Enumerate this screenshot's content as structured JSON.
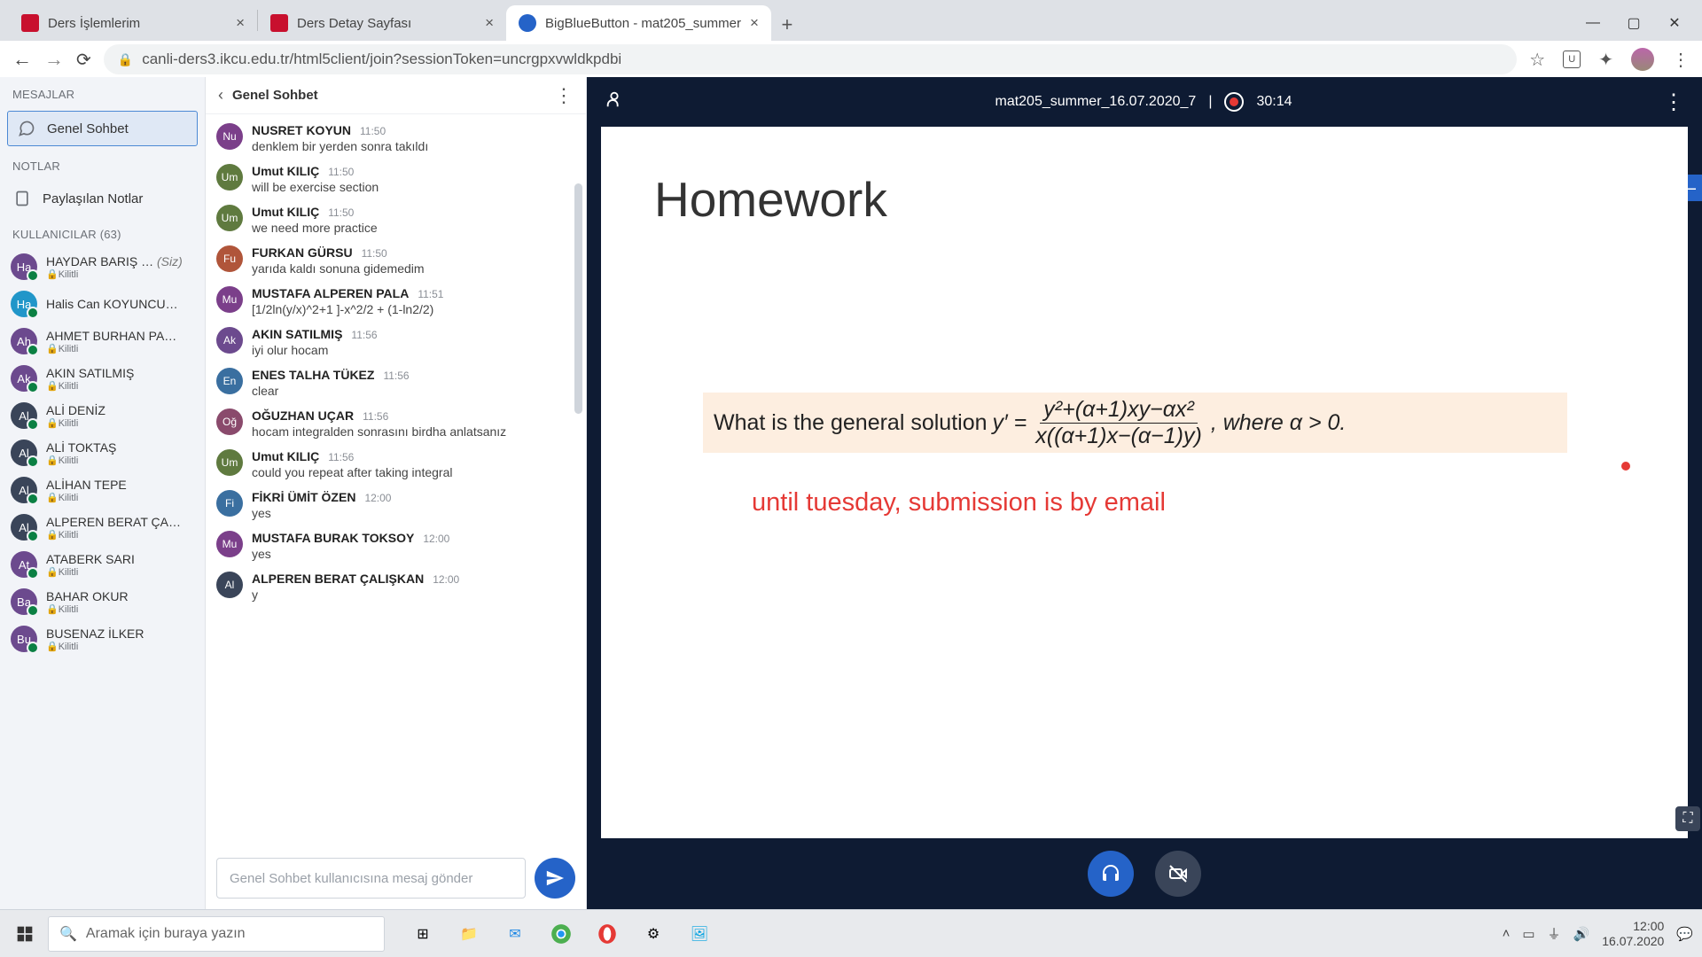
{
  "browser": {
    "tabs": [
      {
        "title": "Ders İşlemlerim",
        "favicon_color": "#c8102e"
      },
      {
        "title": "Ders Detay Sayfası",
        "favicon_color": "#c8102e"
      },
      {
        "title": "BigBlueButton - mat205_summer",
        "favicon_color": "#2563c8",
        "active": true
      }
    ],
    "url": "canli-ders3.ikcu.edu.tr/html5client/join?sessionToken=uncrgpxvwldkpdbi"
  },
  "sidebar": {
    "messages_header": "MESAJLAR",
    "public_chat": "Genel Sohbet",
    "notes_header": "NOTLAR",
    "shared_notes": "Paylaşılan Notlar",
    "users_header": "KULLANICILAR (63)",
    "users": [
      {
        "initials": "Ha",
        "name": "HAYDAR BARIŞ …",
        "suffix": "(Siz)",
        "sub": "Kilitli",
        "color": "#6c4a8e"
      },
      {
        "initials": "Ha",
        "name": "Halis Can KOYUNCU…",
        "sub": "",
        "color": "#2196c9",
        "presenter": true
      },
      {
        "initials": "Ah",
        "name": "AHMET BURHAN PA…",
        "sub": "Kilitli",
        "color": "#6c4a8e"
      },
      {
        "initials": "Ak",
        "name": "AKIN SATILMIŞ",
        "sub": "Kilitli",
        "color": "#6c4a8e"
      },
      {
        "initials": "Al",
        "name": "ALİ DENİZ",
        "sub": "Kilitli",
        "color": "#3a4559"
      },
      {
        "initials": "Al",
        "name": "ALİ TOKTAŞ",
        "sub": "Kilitli",
        "color": "#3a4559"
      },
      {
        "initials": "Al",
        "name": "ALİHAN TEPE",
        "sub": "Kilitli",
        "color": "#3a4559"
      },
      {
        "initials": "Al",
        "name": "ALPEREN BERAT ÇA…",
        "sub": "Kilitli",
        "color": "#3a4559"
      },
      {
        "initials": "At",
        "name": "ATABERK SARI",
        "sub": "Kilitli",
        "color": "#6c4a8e"
      },
      {
        "initials": "Ba",
        "name": "BAHAR OKUR",
        "sub": "Kilitli",
        "color": "#6c4a8e"
      },
      {
        "initials": "Bu",
        "name": "BUSENAZ İLKER",
        "sub": "Kilitli",
        "color": "#6c4a8e"
      }
    ]
  },
  "chat": {
    "title": "Genel Sohbet",
    "placeholder": "Genel Sohbet kullanıcısına mesaj gönder",
    "messages": [
      {
        "initials": "Nu",
        "color": "#7b3f8a",
        "name": "NUSRET KOYUN",
        "time": "11:50",
        "text": "denklem bir yerden sonra takıldı"
      },
      {
        "initials": "Um",
        "color": "#5f7a3f",
        "name": "Umut KILIÇ",
        "time": "11:50",
        "text": "will be exercise section"
      },
      {
        "initials": "Um",
        "color": "#5f7a3f",
        "name": "Umut KILIÇ",
        "time": "11:50",
        "text": "we need more practice"
      },
      {
        "initials": "Fu",
        "color": "#b0553a",
        "name": "FURKAN GÜRSU",
        "time": "11:50",
        "text": "yarıda kaldı sonuna gidemedim"
      },
      {
        "initials": "Mu",
        "color": "#7b3f8a",
        "name": "MUSTAFA ALPEREN PALA",
        "time": "11:51",
        "text": "[1/2ln(y/x)^2+1 ]-x^2/2 + (1-ln2/2)"
      },
      {
        "initials": "Ak",
        "color": "#6c4a8e",
        "name": "AKIN SATILMIŞ",
        "time": "11:56",
        "text": "iyi olur hocam"
      },
      {
        "initials": "En",
        "color": "#3a6fa0",
        "name": "ENES TALHA TÜKEZ",
        "time": "11:56",
        "text": "clear"
      },
      {
        "initials": "Oğ",
        "color": "#8a4a6c",
        "name": "OĞUZHAN UÇAR",
        "time": "11:56",
        "text": "hocam integralden sonrasını birdha anlatsanız"
      },
      {
        "initials": "Um",
        "color": "#5f7a3f",
        "name": "Umut KILIÇ",
        "time": "11:56",
        "text": "could you repeat after taking integral"
      },
      {
        "initials": "Fi",
        "color": "#3a6fa0",
        "name": "FİKRİ ÜMİT ÖZEN",
        "time": "12:00",
        "text": "yes"
      },
      {
        "initials": "Mu",
        "color": "#7b3f8a",
        "name": "MUSTAFA BURAK TOKSOY",
        "time": "12:00",
        "text": "yes"
      },
      {
        "initials": "Al",
        "color": "#3a4559",
        "name": "ALPEREN BERAT ÇALIŞKAN",
        "time": "12:00",
        "text": "y"
      }
    ]
  },
  "stage": {
    "title": "mat205_summer_16.07.2020_7",
    "time": "30:14",
    "slide_heading": "Homework",
    "formula_prefix": "What is the general solution ",
    "formula_numer": "y²+(α+1)xy−αx²",
    "formula_denom": "x((α+1)x−(α−1)y)",
    "formula_suffix": ",  where α > 0.",
    "annotation": "until tuesday, submission is by email"
  },
  "taskbar": {
    "search_placeholder": "Aramak için buraya yazın",
    "time": "12:00",
    "date": "16.07.2020"
  }
}
